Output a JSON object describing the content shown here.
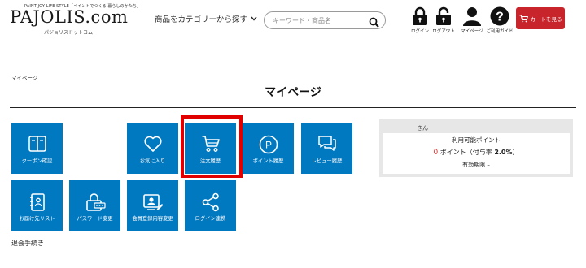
{
  "header": {
    "logo_tagline": "PAINT JOY LIFE STYLE「ペイントでつくる 暮らしのかたち」",
    "logo_text": "PAJOLIS.com",
    "logo_kana": "パジョリスドットコム",
    "category_nav": "商品をカテゴリーから探す",
    "search_placeholder": "キーワード・商品名",
    "icons": [
      {
        "label": "ログイン",
        "icon": "lock-icon"
      },
      {
        "label": "ログアウト",
        "icon": "unlock-icon"
      },
      {
        "label": "マイページ",
        "icon": "user-icon"
      },
      {
        "label": "ご利用ガイド",
        "icon": "help-icon"
      }
    ],
    "cart_label": "カートを見る"
  },
  "breadcrumb": "マイページ",
  "page_title": "マイページ",
  "tiles": [
    {
      "label": "クーポン確認",
      "icon": "coupon-book-icon"
    },
    {
      "label": "お気に入り",
      "icon": "heart-icon"
    },
    {
      "label": "注文履歴",
      "icon": "cart-icon"
    },
    {
      "label": "ポイント履歴",
      "icon": "point-icon"
    },
    {
      "label": "レビュー履歴",
      "icon": "review-icon"
    },
    {
      "label": "お届け先リスト",
      "icon": "address-book-icon"
    },
    {
      "label": "パスワード変更",
      "icon": "password-icon"
    },
    {
      "label": "会員登録内容変更",
      "icon": "member-card-icon"
    },
    {
      "label": "ログイン連携",
      "icon": "share-icon"
    }
  ],
  "withdraw_label": "退会手続き",
  "points": {
    "name_suffix": "さん",
    "title": "利用可能ポイント",
    "value": "0",
    "unit_text": "ポイント（付与率",
    "rate": "2.0%",
    "close": "）",
    "expiry": "有効期限 –"
  },
  "colors": {
    "tile": "#0079c1",
    "highlight": "#e00000",
    "cart": "#c8242b",
    "point_value": "#dd3333"
  }
}
